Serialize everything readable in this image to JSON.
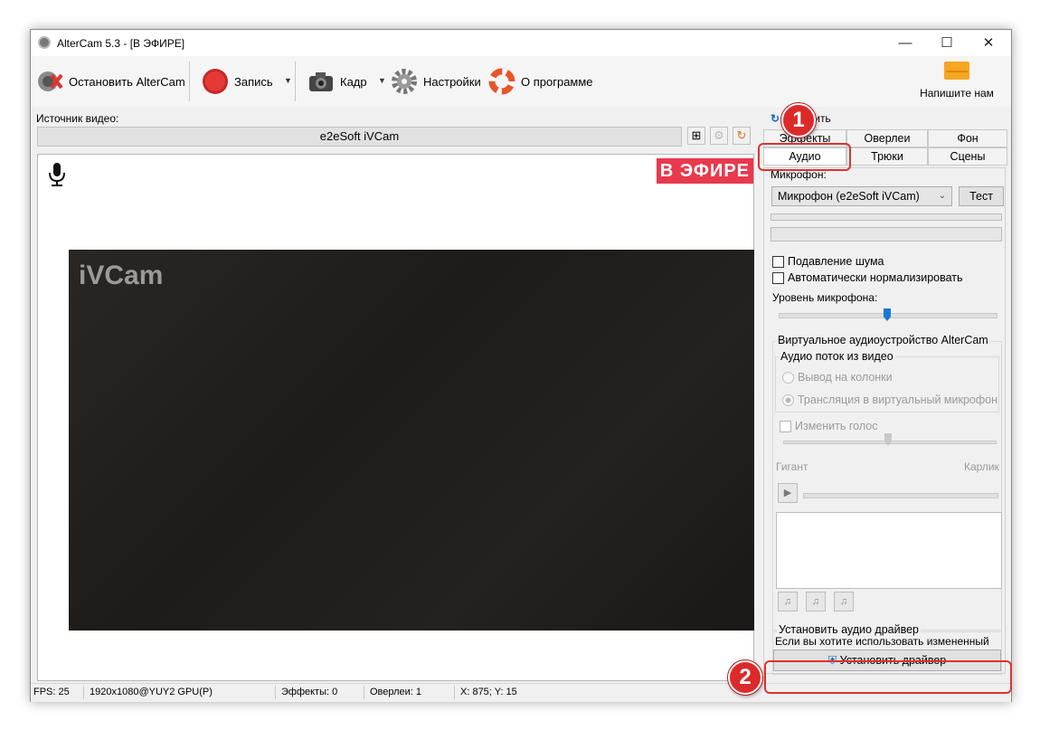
{
  "window": {
    "title": "AlterCam 5.3 - [В ЭФИРЕ]"
  },
  "toolbar": {
    "stop_label": "Остановить AlterCam",
    "record_label": "Запись",
    "frame_label": "Кадр",
    "settings_label": "Настройки",
    "about_label": "О программе",
    "contact_label": "Напишите нам"
  },
  "source": {
    "label": "Источник видео:",
    "value": "e2eSoft iVCam"
  },
  "preview": {
    "onair_badge": "В ЭФИРЕ",
    "watermark": "iVCam"
  },
  "panel": {
    "reset_label": "Сбросить",
    "tabs_row1": [
      "Эффекты",
      "Оверлеи",
      "Фон"
    ],
    "tabs_row2": [
      "Аудио",
      "Трюки",
      "Сцены"
    ],
    "active_tab": "Аудио",
    "microphone_label": "Микрофон:",
    "microphone_value": "Микрофон (e2eSoft iVCam)",
    "test_button": "Тест",
    "noise_suppression": "Подавление шума",
    "auto_normalize": "Автоматически нормализировать",
    "mic_level_label": "Уровень микрофона:",
    "mic_level": 0.5,
    "virtual_device_title": "Виртуальное аудиоустройство AlterCam",
    "stream_group_title": "Аудио поток из видео",
    "radio_speakers": "Вывод на колонки",
    "radio_virtual": "Трансляция в виртуальный микрофон",
    "change_voice": "Изменить голос",
    "giant_label": "Гигант",
    "dwarf_label": "Карлик",
    "driver_group_title": "Установить аудио драйвер",
    "driver_hint": "Если вы хотите использовать измененный",
    "install_button": "Установить драйвер"
  },
  "status": {
    "fps": "FPS: 25",
    "format": "1920x1080@YUY2 GPU(P)",
    "effects": "Эффекты: 0",
    "overlays": "Оверлеи: 1",
    "coords": "X: 875; Y: 15"
  },
  "annotations": {
    "step1": "1",
    "step2": "2"
  },
  "colors": {
    "onair": "#e8394d",
    "annotation": "#dc2a2a",
    "slider_thumb": "#1a78d6"
  }
}
